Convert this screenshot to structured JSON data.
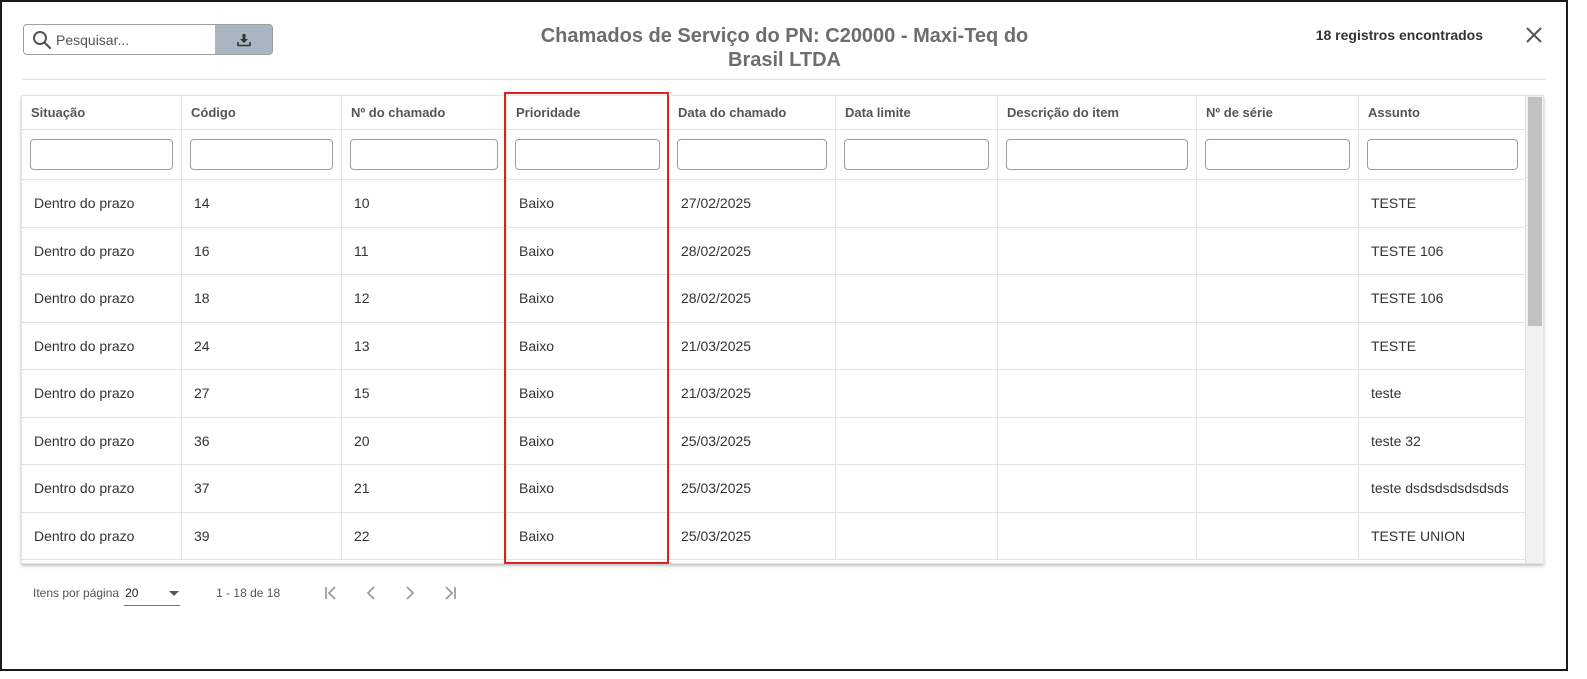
{
  "search": {
    "placeholder": "Pesquisar..."
  },
  "title": "Chamados de Serviço do PN: C20000 - Maxi-Teq do Brasil LTDA",
  "records_found": "18 registros encontrados",
  "icons": {
    "search": "search-icon",
    "download": "download-icon",
    "close": "close-icon",
    "first_page": "first-page-icon",
    "previous_page": "previous-page-icon",
    "next_page": "next-page-icon",
    "last_page": "last-page-icon",
    "dropdown": "chevron-down-icon"
  },
  "colors": {
    "highlight": "#e0221f",
    "download_button": "#a9b6c1"
  },
  "table": {
    "columns": [
      "Situação",
      "Código",
      "Nº do chamado",
      "Prioridade",
      "Data do chamado",
      "Data limite",
      "Descrição do item",
      "Nº de série",
      "Assunto"
    ],
    "rows": [
      [
        "Dentro do prazo",
        "14",
        "10",
        "Baixo",
        "27/02/2025",
        "",
        "",
        "",
        "TESTE"
      ],
      [
        "Dentro do prazo",
        "16",
        "11",
        "Baixo",
        "28/02/2025",
        "",
        "",
        "",
        "TESTE 106"
      ],
      [
        "Dentro do prazo",
        "18",
        "12",
        "Baixo",
        "28/02/2025",
        "",
        "",
        "",
        "TESTE 106"
      ],
      [
        "Dentro do prazo",
        "24",
        "13",
        "Baixo",
        "21/03/2025",
        "",
        "",
        "",
        "TESTE"
      ],
      [
        "Dentro do prazo",
        "27",
        "15",
        "Baixo",
        "21/03/2025",
        "",
        "",
        "",
        "teste"
      ],
      [
        "Dentro do prazo",
        "36",
        "20",
        "Baixo",
        "25/03/2025",
        "",
        "",
        "",
        "teste 32"
      ],
      [
        "Dentro do prazo",
        "37",
        "21",
        "Baixo",
        "25/03/2025",
        "",
        "",
        "",
        "teste dsdsdsdsdsdsds"
      ],
      [
        "Dentro do prazo",
        "39",
        "22",
        "Baixo",
        "25/03/2025",
        "",
        "",
        "",
        "TESTE UNION"
      ]
    ]
  },
  "pagination": {
    "items_per_page_label": "Itens por página",
    "items_per_page_value": "20",
    "range_label": "1 - 18 de 18"
  }
}
